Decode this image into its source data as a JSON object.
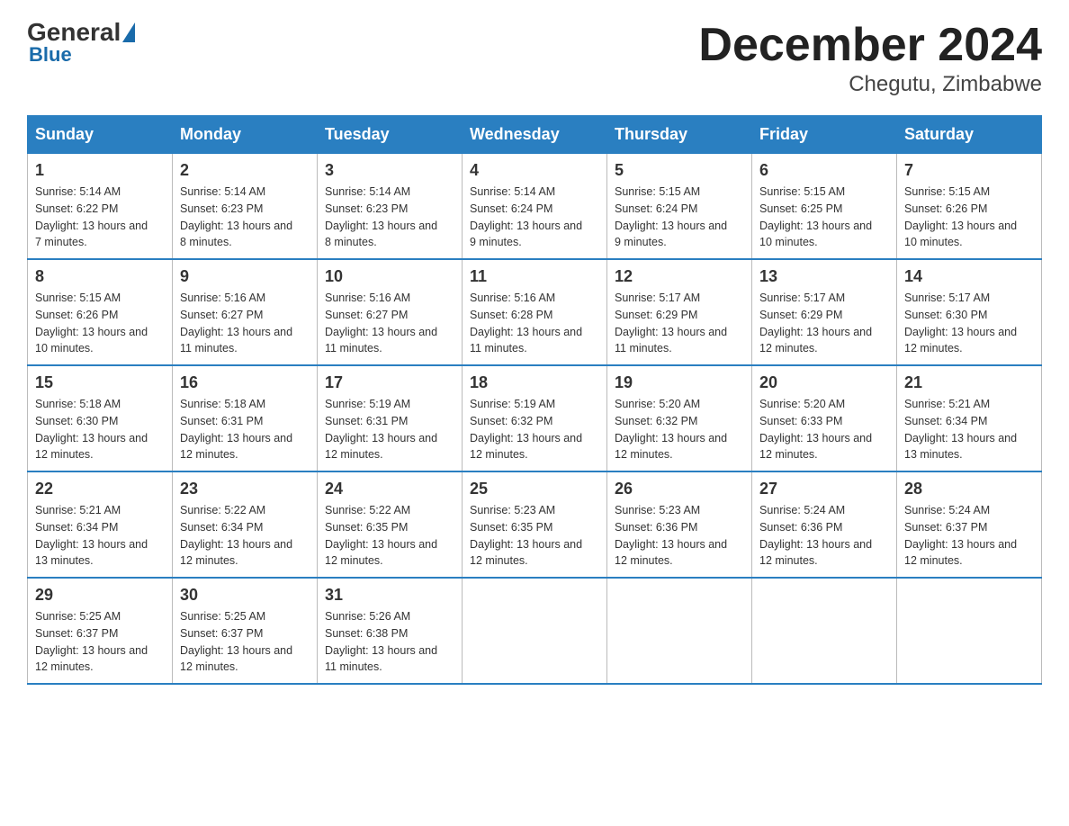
{
  "logo": {
    "general": "General",
    "blue": "Blue"
  },
  "title": "December 2024",
  "subtitle": "Chegutu, Zimbabwe",
  "days_of_week": [
    "Sunday",
    "Monday",
    "Tuesday",
    "Wednesday",
    "Thursday",
    "Friday",
    "Saturday"
  ],
  "weeks": [
    [
      {
        "day": "1",
        "sunrise": "5:14 AM",
        "sunset": "6:22 PM",
        "daylight": "13 hours and 7 minutes."
      },
      {
        "day": "2",
        "sunrise": "5:14 AM",
        "sunset": "6:23 PM",
        "daylight": "13 hours and 8 minutes."
      },
      {
        "day": "3",
        "sunrise": "5:14 AM",
        "sunset": "6:23 PM",
        "daylight": "13 hours and 8 minutes."
      },
      {
        "day": "4",
        "sunrise": "5:14 AM",
        "sunset": "6:24 PM",
        "daylight": "13 hours and 9 minutes."
      },
      {
        "day": "5",
        "sunrise": "5:15 AM",
        "sunset": "6:24 PM",
        "daylight": "13 hours and 9 minutes."
      },
      {
        "day": "6",
        "sunrise": "5:15 AM",
        "sunset": "6:25 PM",
        "daylight": "13 hours and 10 minutes."
      },
      {
        "day": "7",
        "sunrise": "5:15 AM",
        "sunset": "6:26 PM",
        "daylight": "13 hours and 10 minutes."
      }
    ],
    [
      {
        "day": "8",
        "sunrise": "5:15 AM",
        "sunset": "6:26 PM",
        "daylight": "13 hours and 10 minutes."
      },
      {
        "day": "9",
        "sunrise": "5:16 AM",
        "sunset": "6:27 PM",
        "daylight": "13 hours and 11 minutes."
      },
      {
        "day": "10",
        "sunrise": "5:16 AM",
        "sunset": "6:27 PM",
        "daylight": "13 hours and 11 minutes."
      },
      {
        "day": "11",
        "sunrise": "5:16 AM",
        "sunset": "6:28 PM",
        "daylight": "13 hours and 11 minutes."
      },
      {
        "day": "12",
        "sunrise": "5:17 AM",
        "sunset": "6:29 PM",
        "daylight": "13 hours and 11 minutes."
      },
      {
        "day": "13",
        "sunrise": "5:17 AM",
        "sunset": "6:29 PM",
        "daylight": "13 hours and 12 minutes."
      },
      {
        "day": "14",
        "sunrise": "5:17 AM",
        "sunset": "6:30 PM",
        "daylight": "13 hours and 12 minutes."
      }
    ],
    [
      {
        "day": "15",
        "sunrise": "5:18 AM",
        "sunset": "6:30 PM",
        "daylight": "13 hours and 12 minutes."
      },
      {
        "day": "16",
        "sunrise": "5:18 AM",
        "sunset": "6:31 PM",
        "daylight": "13 hours and 12 minutes."
      },
      {
        "day": "17",
        "sunrise": "5:19 AM",
        "sunset": "6:31 PM",
        "daylight": "13 hours and 12 minutes."
      },
      {
        "day": "18",
        "sunrise": "5:19 AM",
        "sunset": "6:32 PM",
        "daylight": "13 hours and 12 minutes."
      },
      {
        "day": "19",
        "sunrise": "5:20 AM",
        "sunset": "6:32 PM",
        "daylight": "13 hours and 12 minutes."
      },
      {
        "day": "20",
        "sunrise": "5:20 AM",
        "sunset": "6:33 PM",
        "daylight": "13 hours and 12 minutes."
      },
      {
        "day": "21",
        "sunrise": "5:21 AM",
        "sunset": "6:34 PM",
        "daylight": "13 hours and 13 minutes."
      }
    ],
    [
      {
        "day": "22",
        "sunrise": "5:21 AM",
        "sunset": "6:34 PM",
        "daylight": "13 hours and 13 minutes."
      },
      {
        "day": "23",
        "sunrise": "5:22 AM",
        "sunset": "6:34 PM",
        "daylight": "13 hours and 12 minutes."
      },
      {
        "day": "24",
        "sunrise": "5:22 AM",
        "sunset": "6:35 PM",
        "daylight": "13 hours and 12 minutes."
      },
      {
        "day": "25",
        "sunrise": "5:23 AM",
        "sunset": "6:35 PM",
        "daylight": "13 hours and 12 minutes."
      },
      {
        "day": "26",
        "sunrise": "5:23 AM",
        "sunset": "6:36 PM",
        "daylight": "13 hours and 12 minutes."
      },
      {
        "day": "27",
        "sunrise": "5:24 AM",
        "sunset": "6:36 PM",
        "daylight": "13 hours and 12 minutes."
      },
      {
        "day": "28",
        "sunrise": "5:24 AM",
        "sunset": "6:37 PM",
        "daylight": "13 hours and 12 minutes."
      }
    ],
    [
      {
        "day": "29",
        "sunrise": "5:25 AM",
        "sunset": "6:37 PM",
        "daylight": "13 hours and 12 minutes."
      },
      {
        "day": "30",
        "sunrise": "5:25 AM",
        "sunset": "6:37 PM",
        "daylight": "13 hours and 12 minutes."
      },
      {
        "day": "31",
        "sunrise": "5:26 AM",
        "sunset": "6:38 PM",
        "daylight": "13 hours and 11 minutes."
      },
      null,
      null,
      null,
      null
    ]
  ]
}
